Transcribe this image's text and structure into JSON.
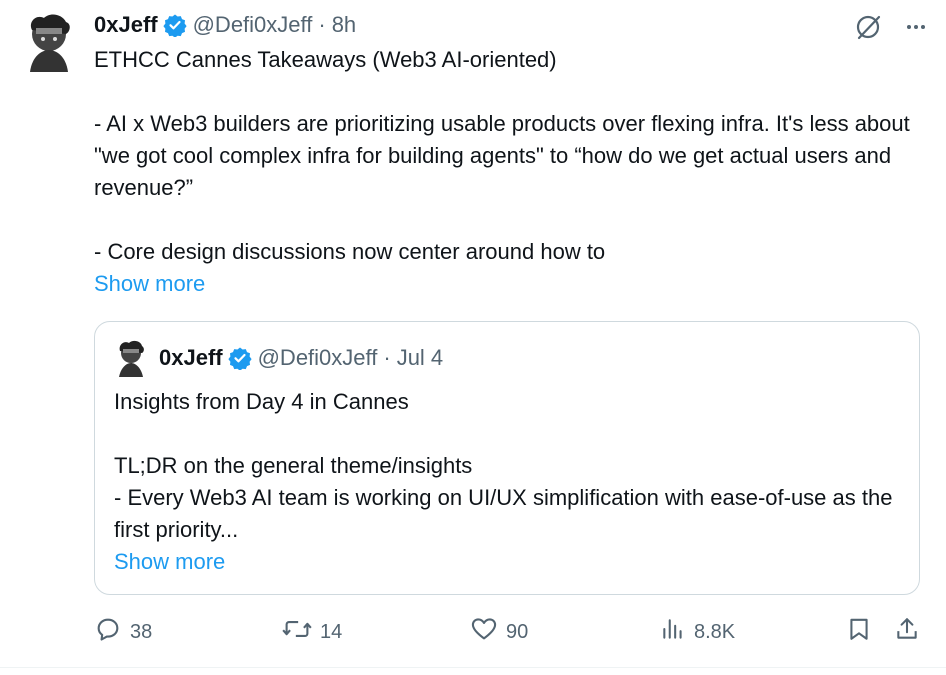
{
  "tweet": {
    "author_name": "0xJeff",
    "author_handle": "@Defi0xJeff",
    "separator": "·",
    "time": "8h",
    "title_line": "ETHCC Cannes Takeaways (Web3 AI-oriented)",
    "paragraph1": "- AI x Web3 builders are prioritizing usable products over flexing infra. It's less about \"we got cool complex infra for building agents\" to “how do we get actual users and revenue?”",
    "paragraph2": "- Core design discussions now center around how to",
    "show_more": "Show more"
  },
  "quote": {
    "author_name": "0xJeff",
    "author_handle": "@Defi0xJeff",
    "separator": "·",
    "date": "Jul 4",
    "line1": "Insights from Day 4 in Cannes",
    "line2": "TL;DR on the general theme/insights",
    "line3": "- Every Web3 AI team is working on UI/UX simplification with ease-of-use as the first priority...",
    "show_more": "Show more"
  },
  "actions": {
    "replies": "38",
    "reposts": "14",
    "likes": "90",
    "views": "8.8K"
  },
  "icons": {
    "verified": "verified-badge-icon",
    "grok": "grok-icon",
    "more": "more-icon",
    "reply": "reply-icon",
    "repost": "repost-icon",
    "like": "heart-icon",
    "views": "views-chart-icon",
    "bookmark": "bookmark-icon",
    "share": "share-icon"
  },
  "colors": {
    "accent": "#1d9bf0",
    "text": "#0f1419",
    "muted": "#536471",
    "border": "#cfd9de"
  }
}
